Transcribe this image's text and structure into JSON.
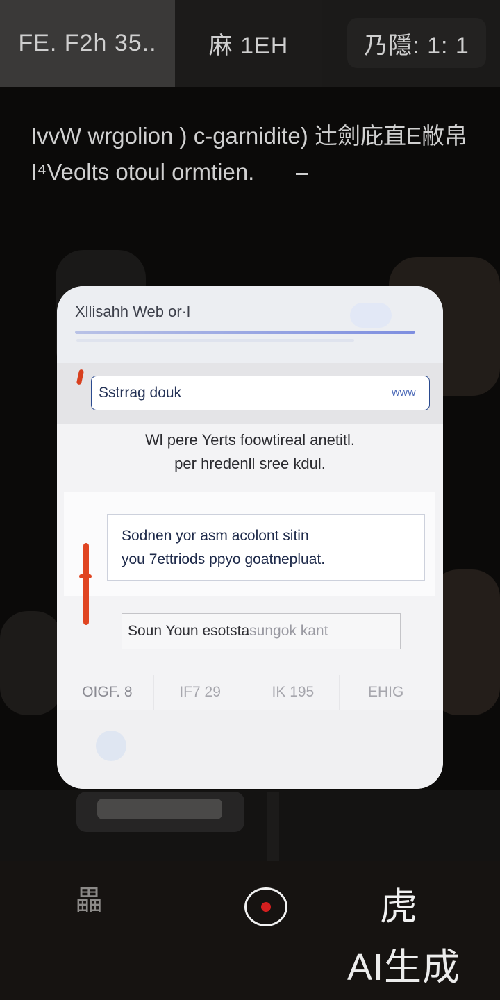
{
  "top_bar": {
    "left": "FE. F2h 35..",
    "middle": "麻 1EH",
    "right": "乃隱: 1: 1"
  },
  "banner": {
    "line1": "IvvW wrgolion ) c-garnidite) 辻劍庇直E敝帛",
    "line2": "I⁴Veolts otoul ormtien."
  },
  "dialog": {
    "title": "Xllisahh Web or·l",
    "search": {
      "value": "Sstrrag douk",
      "suffix": "www"
    },
    "message": {
      "line1": "Wl pere Yerts foowtireal anetitl.",
      "line2": "per hredenll sree kdul."
    },
    "info": {
      "line1": "Sodnen yor asm acolont sitin",
      "line2": "you 7ettriods ppyo goatnepluat."
    },
    "action": {
      "label": "Soun Youn esotsta",
      "faded": " sungok kant"
    },
    "tabs": [
      "OIGF. 8",
      "IF7 29",
      "IK 195",
      "EHIG"
    ]
  },
  "bottom_nav": {
    "left_icon": "gallery-icon",
    "center_icon": "record-icon",
    "right_icon": "flash-icon",
    "left_glyph": "畾",
    "right_glyph": "虎"
  },
  "watermark": "AI生成",
  "colors": {
    "accent_red": "#E04522",
    "input_border": "#2A4A8F",
    "card_bg": "#F3F3F5"
  }
}
